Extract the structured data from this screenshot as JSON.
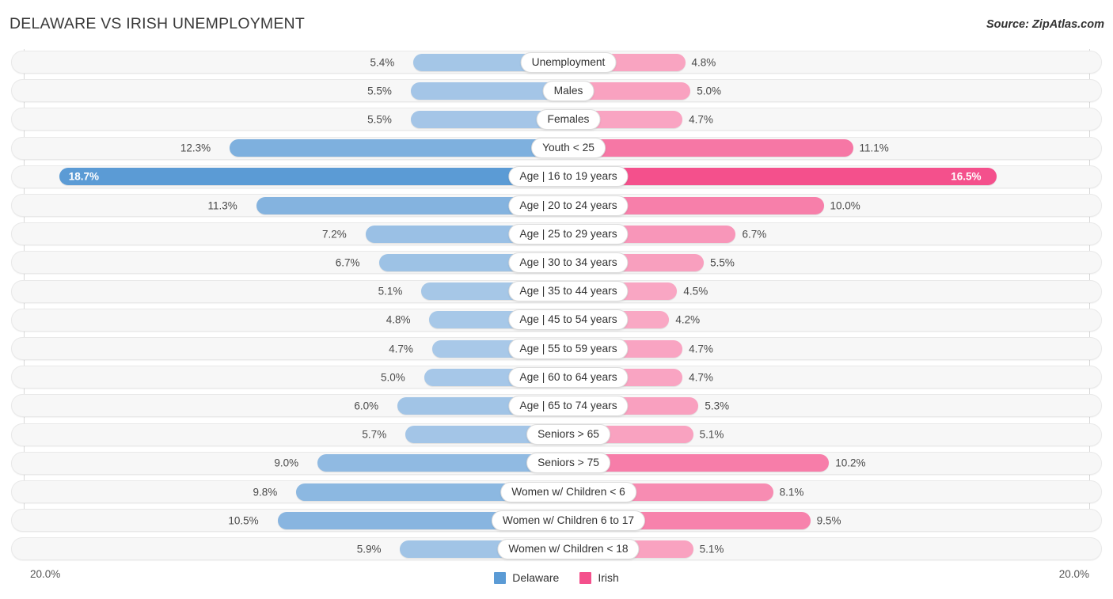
{
  "header": {
    "title": "DELAWARE VS IRISH UNEMPLOYMENT",
    "source": "Source: ZipAtlas.com"
  },
  "axis": {
    "left_max": "20.0%",
    "right_max": "20.0%"
  },
  "legend": {
    "items": [
      {
        "label": "Delaware",
        "color": "#5b9bd5"
      },
      {
        "label": "Irish",
        "color": "#f4508c"
      }
    ]
  },
  "colors": {
    "left_min": "#a8c8e8",
    "left_max": "#5b9bd5",
    "right_min": "#f9a8c4",
    "right_max": "#f4508c",
    "track": "#f7f7f7",
    "gridline": "#d8d8d8"
  },
  "chart_data": {
    "type": "bar",
    "orientation": "horizontal-diverging",
    "title": "DELAWARE VS IRISH UNEMPLOYMENT",
    "xlabel": "",
    "ylabel": "",
    "xlim": [
      0,
      20
    ],
    "unit": "%",
    "grid": true,
    "legend_position": "bottom-center",
    "categories": [
      "Unemployment",
      "Males",
      "Females",
      "Youth < 25",
      "Age | 16 to 19 years",
      "Age | 20 to 24 years",
      "Age | 25 to 29 years",
      "Age | 30 to 34 years",
      "Age | 35 to 44 years",
      "Age | 45 to 54 years",
      "Age | 55 to 59 years",
      "Age | 60 to 64 years",
      "Age | 65 to 74 years",
      "Seniors > 65",
      "Seniors > 75",
      "Women w/ Children < 6",
      "Women w/ Children 6 to 17",
      "Women w/ Children < 18"
    ],
    "series": [
      {
        "name": "Delaware",
        "side": "left",
        "color": "#5b9bd5",
        "values": [
          5.4,
          5.5,
          5.5,
          12.3,
          18.7,
          11.3,
          7.2,
          6.7,
          5.1,
          4.8,
          4.7,
          5.0,
          6.0,
          5.7,
          9.0,
          9.8,
          10.5,
          5.9
        ],
        "labels": [
          "5.4%",
          "5.5%",
          "5.5%",
          "12.3%",
          "18.7%",
          "11.3%",
          "7.2%",
          "6.7%",
          "5.1%",
          "4.8%",
          "4.7%",
          "5.0%",
          "6.0%",
          "5.7%",
          "9.0%",
          "9.8%",
          "10.5%",
          "5.9%"
        ]
      },
      {
        "name": "Irish",
        "side": "right",
        "color": "#f4508c",
        "values": [
          4.8,
          5.0,
          4.7,
          11.1,
          16.5,
          10.0,
          6.7,
          5.5,
          4.5,
          4.2,
          4.7,
          4.7,
          5.3,
          5.1,
          10.2,
          8.1,
          9.5,
          5.1
        ],
        "labels": [
          "4.8%",
          "5.0%",
          "4.7%",
          "11.1%",
          "16.5%",
          "10.0%",
          "6.7%",
          "5.5%",
          "4.5%",
          "4.2%",
          "4.7%",
          "4.7%",
          "5.3%",
          "5.1%",
          "10.2%",
          "8.1%",
          "9.5%",
          "5.1%"
        ]
      }
    ]
  }
}
